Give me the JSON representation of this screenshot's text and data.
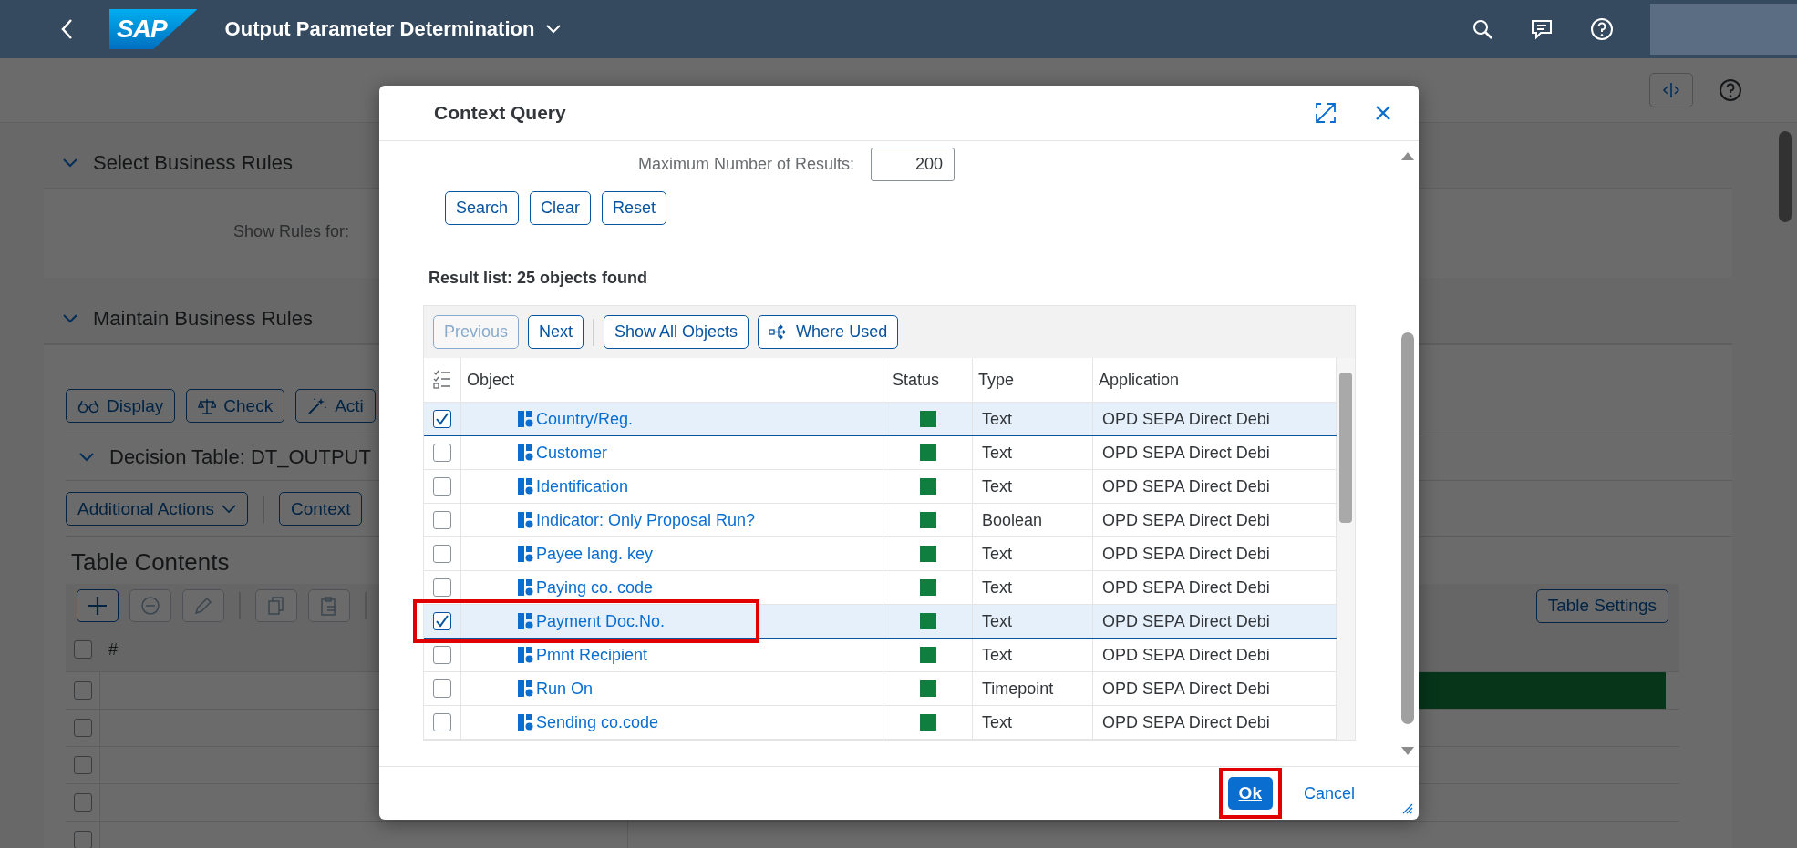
{
  "shell": {
    "logo": "SAP",
    "title": "Output Parameter Determination"
  },
  "sections": [
    {
      "title": "Select Business Rules",
      "expanded": true
    },
    {
      "title": "Maintain Business Rules",
      "expanded": true
    }
  ],
  "show_rules_label": "Show Rules for:",
  "rule_actions": [
    {
      "label": "Display",
      "kind": "display"
    },
    {
      "label": "Check",
      "kind": "check"
    },
    {
      "label": "Acti",
      "kind": "activate"
    }
  ],
  "decision_table": {
    "title": "Decision Table: DT_OUTPUT",
    "expanded": true
  },
  "table_actions": [
    {
      "label": "Additional Actions",
      "kind": "menu"
    },
    {
      "label": "Context",
      "kind": "button"
    }
  ],
  "table_contents": {
    "title": "Table Contents",
    "settings_button": "Table Settings",
    "column": "#",
    "all_checked": false,
    "rows": [
      {
        "checked": false,
        "highlighted": true
      },
      {
        "checked": false,
        "highlighted": false
      },
      {
        "checked": false,
        "highlighted": false
      },
      {
        "checked": false,
        "highlighted": false
      },
      {
        "checked": false,
        "highlighted": false
      }
    ]
  },
  "dialog": {
    "title": "Context Query",
    "max_results_label": "Maximum Number of Results:",
    "max_results": "200",
    "search_buttons": [
      "Search",
      "Clear",
      "Reset"
    ],
    "result_summary": "Result list: 25  objects found",
    "toolbar": [
      {
        "label": "Previous",
        "kind": "button",
        "disabled": true
      },
      {
        "label": "Next",
        "kind": "button",
        "disabled": false
      },
      {
        "label": "Show All Objects",
        "kind": "button",
        "disabled": false
      },
      {
        "label": "Where Used",
        "kind": "icon-button",
        "disabled": false
      }
    ],
    "columns": [
      "Object",
      "Status",
      "Type",
      "Application"
    ],
    "rows": [
      {
        "object": "Country/Reg.",
        "color": "#107e3e",
        "type": "Text",
        "application": "OPD SEPA Direct Debi",
        "selected": true,
        "highlighted": false
      },
      {
        "object": "Customer",
        "color": "#107e3e",
        "type": "Text",
        "application": "OPD SEPA Direct Debi",
        "selected": false,
        "highlighted": false
      },
      {
        "object": "Identification",
        "color": "#107e3e",
        "type": "Text",
        "application": "OPD SEPA Direct Debi",
        "selected": false,
        "highlighted": false
      },
      {
        "object": "Indicator: Only Proposal Run?",
        "color": "#107e3e",
        "type": "Boolean",
        "application": "OPD SEPA Direct Debi",
        "selected": false,
        "highlighted": false
      },
      {
        "object": "Payee lang. key",
        "color": "#107e3e",
        "type": "Text",
        "application": "OPD SEPA Direct Debi",
        "selected": false,
        "highlighted": false
      },
      {
        "object": "Paying co. code",
        "color": "#107e3e",
        "type": "Text",
        "application": "OPD SEPA Direct Debi",
        "selected": false,
        "highlighted": false
      },
      {
        "object": "Payment Doc.No.",
        "color": "#107e3e",
        "type": "Text",
        "application": "OPD SEPA Direct Debi",
        "selected": true,
        "highlighted": true
      },
      {
        "object": "Pmnt Recipient",
        "color": "#107e3e",
        "type": "Text",
        "application": "OPD SEPA Direct Debi",
        "selected": false,
        "highlighted": false
      },
      {
        "object": "Run On",
        "color": "#107e3e",
        "type": "Timepoint",
        "application": "OPD SEPA Direct Debi",
        "selected": false,
        "highlighted": false
      },
      {
        "object": "Sending co.code",
        "color": "#107e3e",
        "type": "Text",
        "application": "OPD SEPA Direct Debi",
        "selected": false,
        "highlighted": false
      }
    ],
    "footer": [
      {
        "label": "Ok",
        "kind": "emphasized",
        "highlighted": true
      },
      {
        "label": "Cancel",
        "kind": "link",
        "highlighted": false
      }
    ]
  }
}
